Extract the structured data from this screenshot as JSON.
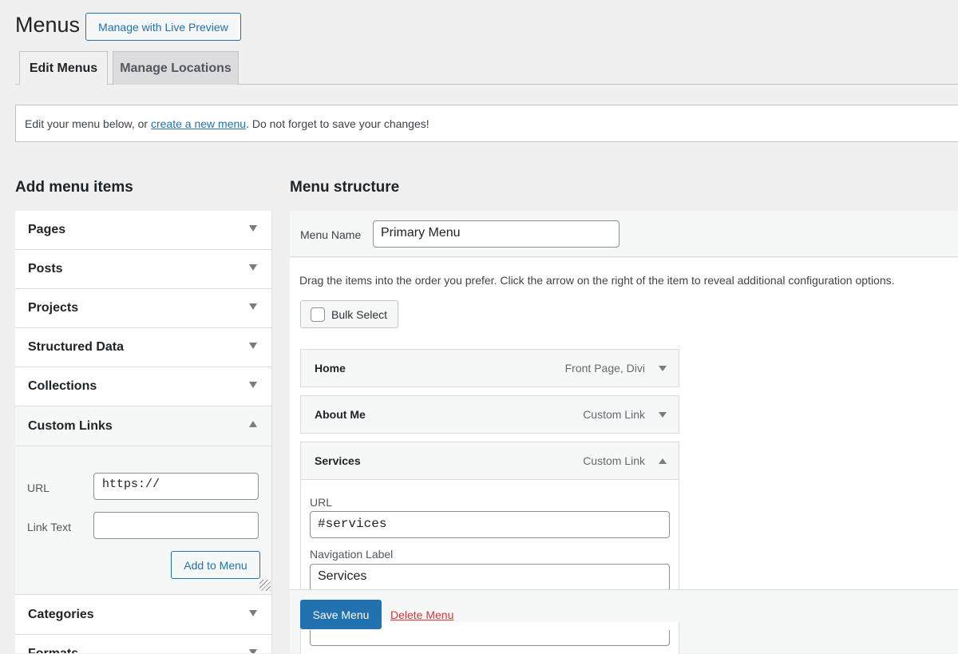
{
  "header": {
    "title": "Menus",
    "live_preview_label": "Manage with Live Preview"
  },
  "tabs": [
    {
      "label": "Edit Menus"
    },
    {
      "label": "Manage Locations"
    }
  ],
  "notice": {
    "prefix": "Edit your menu below, or ",
    "link": "create a new menu",
    "suffix": ". Do not forget to save your changes!"
  },
  "add_items": {
    "title": "Add menu items",
    "sections": [
      {
        "label": "Pages"
      },
      {
        "label": "Posts"
      },
      {
        "label": "Projects"
      },
      {
        "label": "Structured Data"
      },
      {
        "label": "Collections"
      },
      {
        "label": "Custom Links"
      },
      {
        "label": "Categories"
      },
      {
        "label": "Formats"
      }
    ],
    "custom_links": {
      "url_label": "URL",
      "url_value": "https://",
      "link_text_label": "Link Text",
      "link_text_value": "",
      "add_button": "Add to Menu"
    }
  },
  "structure": {
    "title": "Menu structure",
    "menu_name_label": "Menu Name",
    "menu_name_value": "Primary Menu",
    "help_text": "Drag the items into the order you prefer. Click the arrow on the right of the item to reveal additional configuration options.",
    "bulk_select_label": "Bulk Select",
    "items": [
      {
        "title": "Home",
        "type": "Front Page, Divi"
      },
      {
        "title": "About Me",
        "type": "Custom Link"
      },
      {
        "title": "Services",
        "type": "Custom Link"
      }
    ],
    "open_item": {
      "url_label": "URL",
      "url_value": "#services",
      "nav_label_label": "Navigation Label",
      "nav_label_value": "Services"
    },
    "save_label": "Save Menu",
    "delete_label": "Delete Menu"
  },
  "colors": {
    "accent": "#2271b1",
    "danger": "#d63638",
    "background": "#f0f0f1"
  }
}
